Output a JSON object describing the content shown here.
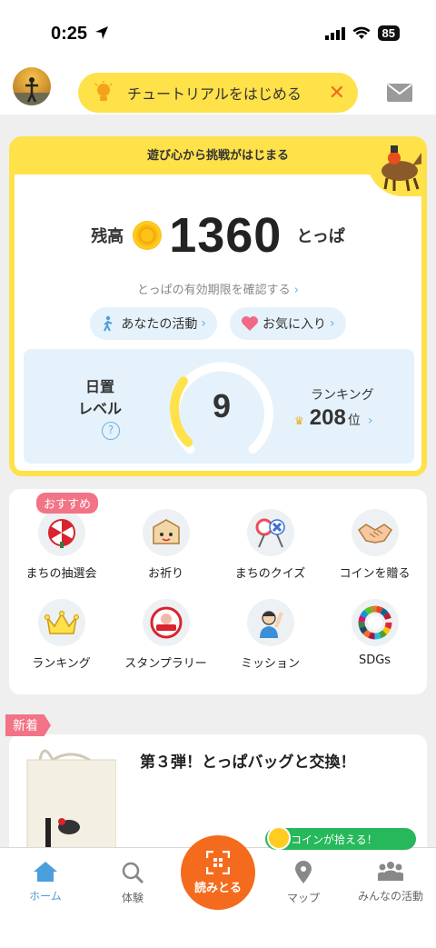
{
  "status_bar": {
    "time": "0:25",
    "battery": "85"
  },
  "header": {
    "tutorial_text": "チュートリアルをはじめる",
    "close_glyph": "✕"
  },
  "balance_card": {
    "banner": "遊び心から挑戦がはじまる",
    "balance_label": "残高",
    "balance_value": "1360",
    "balance_unit": "とっぱ",
    "expiry_link": "とっぱの有効期限を確認する",
    "chip_activity": "あなたの活動",
    "chip_favorites": "お気に入り",
    "level_label_line1": "日置",
    "level_label_line2": "レベル",
    "help_glyph": "?",
    "level_value": "9",
    "level_progress": 0.3,
    "ranking_label": "ランキング",
    "ranking_value": "208",
    "ranking_unit": "位"
  },
  "menu": {
    "recommend_badge": "おすすめ",
    "items": [
      {
        "label": "まちの抽選会",
        "icon": "lottery-icon"
      },
      {
        "label": "お祈り",
        "icon": "ema-prayer-icon"
      },
      {
        "label": "まちのクイズ",
        "icon": "quiz-icon"
      },
      {
        "label": "コインを贈る",
        "icon": "handshake-icon"
      },
      {
        "label": "ランキング",
        "icon": "crown-icon"
      },
      {
        "label": "スタンプラリー",
        "icon": "stamp-clear-icon"
      },
      {
        "label": "ミッション",
        "icon": "mission-person-icon"
      },
      {
        "label": "SDGs",
        "icon": "sdgs-wheel-icon"
      }
    ]
  },
  "promo": {
    "new_tag": "新着",
    "title": "第３弾！とっぱバッグと交換！"
  },
  "toast": {
    "text": "コインが拾える！"
  },
  "bottom_nav": {
    "home": "ホーム",
    "experience": "体験",
    "scan": "読みとる",
    "map": "マップ",
    "community": "みんなの活動"
  },
  "colors": {
    "accent_yellow": "#ffe14a",
    "scan_orange": "#f46b1e",
    "active_blue": "#4a9fdb",
    "badge_pink": "#f27385",
    "toast_green": "#26b85a"
  }
}
